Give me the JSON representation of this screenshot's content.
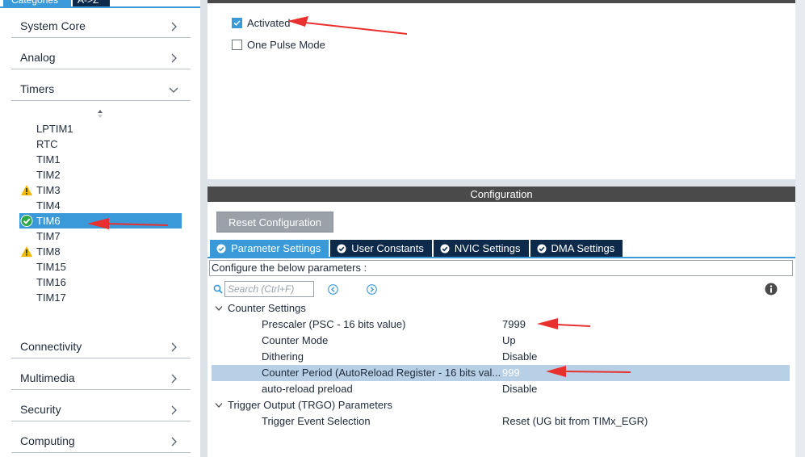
{
  "sidebar": {
    "tabs": {
      "categories": "Categories",
      "az": "A->Z"
    },
    "categories": [
      {
        "label": "System Core"
      },
      {
        "label": "Analog"
      },
      {
        "label": "Timers"
      },
      {
        "label": "Connectivity"
      },
      {
        "label": "Multimedia"
      },
      {
        "label": "Security"
      },
      {
        "label": "Computing"
      }
    ],
    "timers": [
      {
        "label": "LPTIM1",
        "status": "none"
      },
      {
        "label": "RTC",
        "status": "none"
      },
      {
        "label": "TIM1",
        "status": "none"
      },
      {
        "label": "TIM2",
        "status": "none"
      },
      {
        "label": "TIM3",
        "status": "warning"
      },
      {
        "label": "TIM4",
        "status": "none"
      },
      {
        "label": "TIM6",
        "status": "ok"
      },
      {
        "label": "TIM7",
        "status": "none"
      },
      {
        "label": "TIM8",
        "status": "warning"
      },
      {
        "label": "TIM15",
        "status": "none"
      },
      {
        "label": "TIM16",
        "status": "none"
      },
      {
        "label": "TIM17",
        "status": "none"
      }
    ],
    "selected_timer": "TIM6"
  },
  "mode": {
    "activated": {
      "label": "Activated",
      "checked": true
    },
    "one_pulse": {
      "label": "One Pulse Mode",
      "checked": false
    }
  },
  "configuration": {
    "header": "Configuration",
    "reset_button": "Reset Configuration",
    "tabs": [
      {
        "label": "Parameter Settings",
        "active": true
      },
      {
        "label": "User Constants",
        "active": false
      },
      {
        "label": "NVIC Settings",
        "active": false
      },
      {
        "label": "DMA Settings",
        "active": false
      }
    ],
    "description": "Configure the below parameters :",
    "search": {
      "placeholder": "Search (Ctrl+F)"
    },
    "groups": [
      {
        "label": "Counter Settings",
        "params": [
          {
            "name": "Prescaler (PSC - 16 bits value)",
            "value": "7999",
            "highlight": false
          },
          {
            "name": "Counter Mode",
            "value": "Up",
            "highlight": false
          },
          {
            "name": "Dithering",
            "value": "Disable",
            "highlight": false
          },
          {
            "name": "Counter Period (AutoReload Register - 16 bits val...",
            "value": "999",
            "highlight": true
          },
          {
            "name": "auto-reload preload",
            "value": "Disable",
            "highlight": false
          }
        ]
      },
      {
        "label": "Trigger Output (TRGO) Parameters",
        "params": [
          {
            "name": "Trigger Event Selection",
            "value": "Reset (UG bit from TIMx_EGR)",
            "highlight": false
          }
        ]
      }
    ]
  },
  "colors": {
    "accent": "#3a9ad9",
    "navy": "#0d2a4a",
    "annotation_arrow": "#e8312f",
    "warning": "#f5b800",
    "ok": "#2ea84a"
  }
}
